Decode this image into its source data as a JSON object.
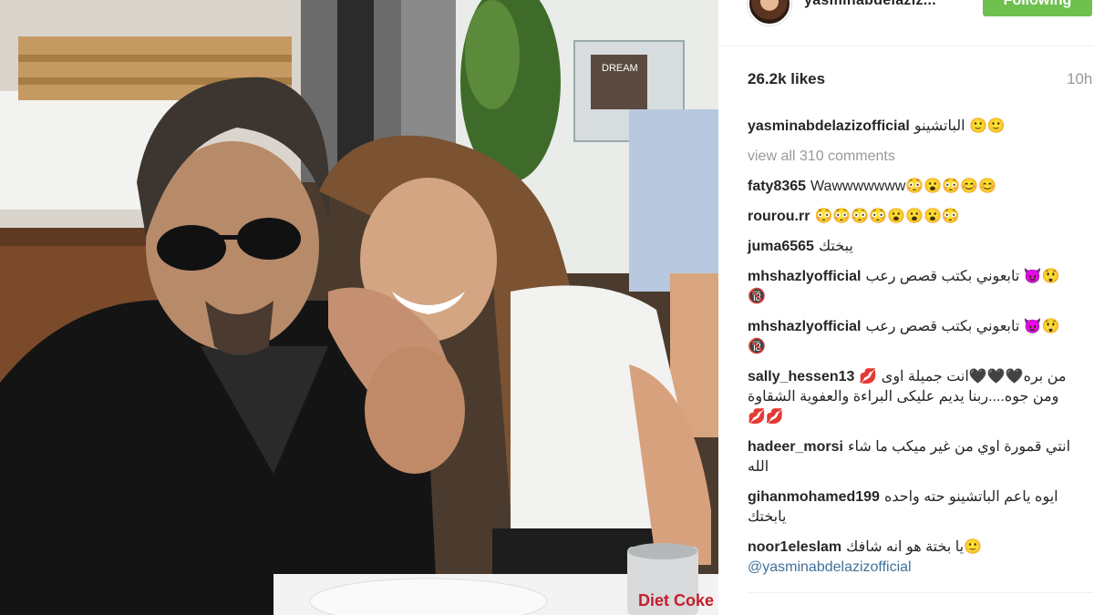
{
  "header": {
    "username": "yasminabdelaziz...",
    "follow_label": "Following"
  },
  "stats": {
    "likes": "26.2k likes",
    "time": "10h"
  },
  "caption": {
    "user": "yasminabdelazizofficial",
    "text": "الباتشينو 🙂🙂"
  },
  "view_all_comments": "view all 310 comments",
  "comments": [
    {
      "user": "faty8365",
      "text": "Wawwwwwww😳😮😳😊😊"
    },
    {
      "user": "rourou.rr",
      "text": "😳😳😳😳😮😮😮😳"
    },
    {
      "user": "juma6565",
      "text": "يبختك"
    },
    {
      "user": "mhshazlyofficial",
      "text": "تابعوني بكتب قصص رعب 😈😲🔞"
    },
    {
      "user": "mhshazlyofficial",
      "text": "تابعوني بكتب قصص رعب 😈😲🔞"
    },
    {
      "user": "sally_hessen13",
      "text": "من بره🖤🖤🖤انت جميلة اوى 💋ومن جوه....ربنا يديم عليكى البراءة والعفوية الشقاوة 💋💋"
    },
    {
      "user": "hadeer_morsi",
      "text": "انتي قمورة اوي من غير ميكب ما شاء الله"
    },
    {
      "user": "gihanmohamed199",
      "text": "ايوه ياعم الباتشينو حته واحده يابختك"
    },
    {
      "user": "noor1eleslam",
      "text": "يا بختة هو انه شافك🙂",
      "mention": "@yasminabdelazizofficial"
    }
  ],
  "photo": {
    "can_text": "Diet Coke",
    "sign_text": "DREAM"
  }
}
